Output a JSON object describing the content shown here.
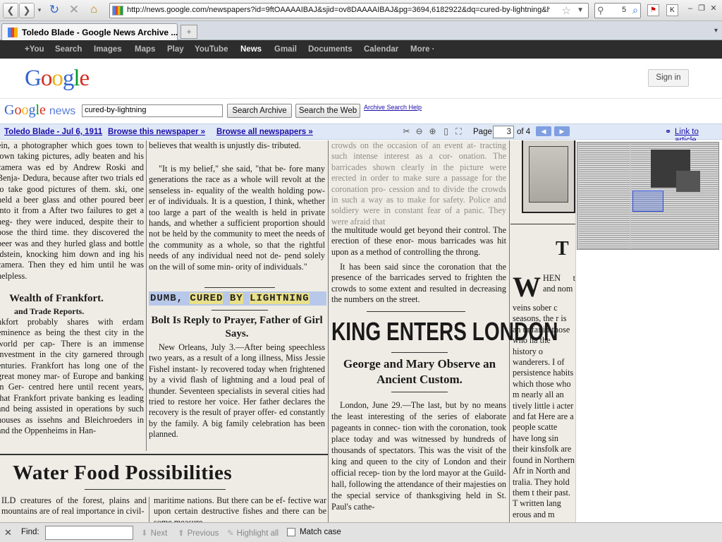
{
  "browser": {
    "url": "http://news.google.com/newspapers?id=9ftOAAAAIBAJ&sjid=ov8DAAAAIBAJ&pg=3694,6182922&dq=cured-by-lightning&hl=",
    "search_value": "5",
    "tab_title": "Toledo Blade - Google News Archive ...",
    "new_tab": "+",
    "tab_list": "▾"
  },
  "google_bar": {
    "items": [
      "+You",
      "Search",
      "Images",
      "Maps",
      "Play",
      "YouTube",
      "News",
      "Gmail",
      "Documents",
      "Calendar",
      "More ·"
    ]
  },
  "header": {
    "sign_in": "Sign in",
    "news_label": "news",
    "query": "cured-by-lightning",
    "search_archive": "Search Archive",
    "search_web": "Search the Web",
    "archive_help": "Archive Search Help"
  },
  "viewer": {
    "paper_date": "Toledo Blade - Jul 6, 1911",
    "browse_paper": "Browse this newspaper »",
    "browse_all": "Browse all newspapers »",
    "page_label": "Page",
    "page_value": "3",
    "page_of": "of 4",
    "link_article": "Link to article"
  },
  "article": {
    "col1": [
      "ein, a photographer which goes town to town taking pictures, adly beaten and his camera was ed by Andrew Roski and Benja- Dedura, because after two trials ed to take good pictures of them. ski, one held a beer glass and other poured beer into it from a After two failures to get a neg- they were induced, despite their to pose the third time. they discovered the beer was and they hurled glass and bottle ldstein, knocking him down and ing his camera. Then they ed him until he was helpless."
    ],
    "col1_head": "Wealth of Frankfort.",
    "col1_sub": "and Trade Reports.",
    "col1b": "nkfort probably shares with erdam eminence as being the thest city in the world per cap- There is an immense investment in the city garnered through enturies. Frankfort has long one of the great money mar- of Europe and banking in Ger- centred here until recent years, that Frankfort private banking es leading and being assisted in operations by such houses as issehns and Bleichroeders in and the Oppenheims in Han-",
    "col2a": "believes that wealth is unjustly dis- tributed.",
    "col2b": "\"It is my belief,\" she said, \"that be- fore many generations the race as a whole will revolt at the senseless in- equality of the wealth holding pow- er of individuals. It is a question, I think, whether too large a part of the wealth is held in private hands, and whether a sufficient proportion should not be held by the community to meet the needs of the community as a whole, so that the rightful needs of any individual need not de- pend solely on the will of some min- ority of individuals.\"",
    "headline_pre": "DUMB, ",
    "headline_w1": "CURED",
    "headline_w2": "BY",
    "headline_w3": "LIGHTNING",
    "subhead": "Bolt Is Reply to Prayer, Father of Girl Says.",
    "col2c": "New Orleans, July 3.—After being speechless two years, as a result of a long illness, Miss Jessie Fishel instant- ly recovered today when frightened by a vivid flash of lightning and a loud peal of thunder. Seventeen specialists in several cities had tried to restore her voice. Her father declares the recovery is the result of prayer offer- ed constantly by the family. A big family celebration has been planned.",
    "col3_faint": "crowds on the occasion of an event at- tracting such intense interest as a cor- onation. The barricades shown clearly in the picture were erected in order to make sure a passage for the coronation pro- cession and to divide the crowds in such a way as to make for safety. Police and soldiery were in constant fear of a panic. They were afraid that",
    "col3a": "the multitude would get beyond their control. The erection of these enor- mous barricades was hit upon as a method of controlling the throng.",
    "col3b": "It has been said since the coronation that the presence of the barricades served to frighten the crowds to some extent and resulted in decreasing the numbers on the street.",
    "king_headline": "KING ENTERS LONDON",
    "king_sub": "George and Mary Observe an Ancient Custom.",
    "col3c": "London, June 29.—The last, but by no means the least interesting of the series of elaborate pageants in connec- tion with the coronation, took place today and was witnessed by hundreds of thousands of spectators. This was the visit of the king and queen to the city of London and their official recep- tion by the lord mayor at the Guild- hall, following the attendance of their majesties on the special service of thanksgiving held in St. Paul's cathe-",
    "col4": "veins sober c seasons, the r is an unfailin those who ha the history o wanderers. I of persistence habits which those who m nearly all an tively little i acter and fat Here are a people scatte have long sin their kinsfolk are found in Northern Afr in North and tralia. They hold them t their past. T written lang erous and m",
    "col4_dropcap": "W",
    "col4_top": "HEN t and nom",
    "col4_bigT": "T",
    "water_headline": "Water Food Possibilities",
    "water_c1": "ILD creatures of the forest, plains and mountains are of real importance in civil-",
    "water_c2": "maritime nations. But there can be ef- fective war upon certain destructive fishes and there can be some measure"
  },
  "findbar": {
    "close": "✕",
    "label": "Find:",
    "next": "Next",
    "previous": "Previous",
    "highlight": "Highlight all",
    "match_case": "Match case"
  }
}
